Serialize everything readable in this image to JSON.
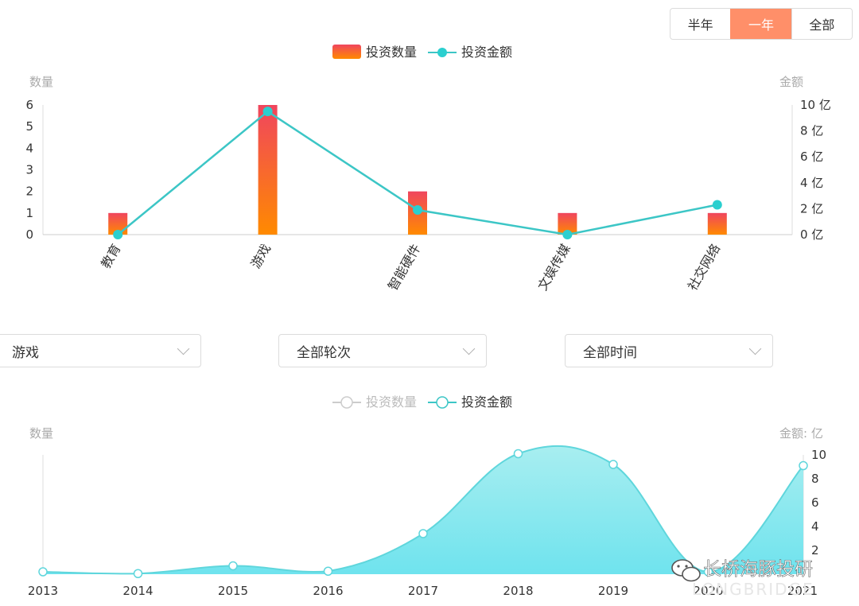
{
  "range_tabs": [
    {
      "label": "半年",
      "active": false
    },
    {
      "label": "一年",
      "active": true
    },
    {
      "label": "全部",
      "active": false
    }
  ],
  "filters": {
    "industry": "游戏",
    "round": "全部轮次",
    "time": "全部时间"
  },
  "colors": {
    "bar_top": "#f0455e",
    "bar_bottom": "#ff8a00",
    "line": "#3cc6c6",
    "point": "#2bcfcf",
    "area_top": "#a8eef0",
    "area_bottom": "#6fe3ee",
    "accent": "#ff8f69"
  },
  "chart_data": [
    {
      "type": "bar",
      "legend": [
        "投资数量",
        "投资金额"
      ],
      "y_left_label": "数量",
      "y_right_label": "金额",
      "y_left_ticks": [
        "0",
        "1",
        "2",
        "3",
        "4",
        "5",
        "6"
      ],
      "y_right_ticks": [
        "0 亿",
        "2 亿",
        "4 亿",
        "6 亿",
        "8 亿",
        "10 亿"
      ],
      "categories": [
        "教育",
        "游戏",
        "智能硬件",
        "文娱传媒",
        "社交网络"
      ],
      "series": [
        {
          "name": "投资数量",
          "type": "bar",
          "axis": "left",
          "values": [
            1,
            6,
            2,
            1,
            1
          ]
        },
        {
          "name": "投资金额",
          "type": "line",
          "axis": "right",
          "values": [
            0,
            9.5,
            1.9,
            0,
            2.3
          ]
        }
      ],
      "ylim_left": [
        0,
        6
      ],
      "ylim_right": [
        0,
        10
      ]
    },
    {
      "type": "area",
      "legend": [
        "投资数量",
        "投资金额"
      ],
      "y_left_label": "数量",
      "y_right_label": "金额: 亿",
      "y_right_ticks": [
        "2",
        "4",
        "6",
        "8",
        "10"
      ],
      "x": [
        "2013",
        "2014",
        "2015",
        "2016",
        "2017",
        "2018",
        "2019",
        "2020",
        "2021"
      ],
      "series": [
        {
          "name": "投资金额",
          "type": "area",
          "axis": "right",
          "values": [
            0.2,
            0.05,
            0.7,
            0.25,
            3.4,
            10.1,
            9.2,
            0.2,
            9.1
          ]
        }
      ],
      "ylim_right": [
        0,
        10
      ]
    }
  ],
  "watermark": {
    "text": "长桥海豚投研",
    "faint_text": "LONGBRIDGE"
  }
}
